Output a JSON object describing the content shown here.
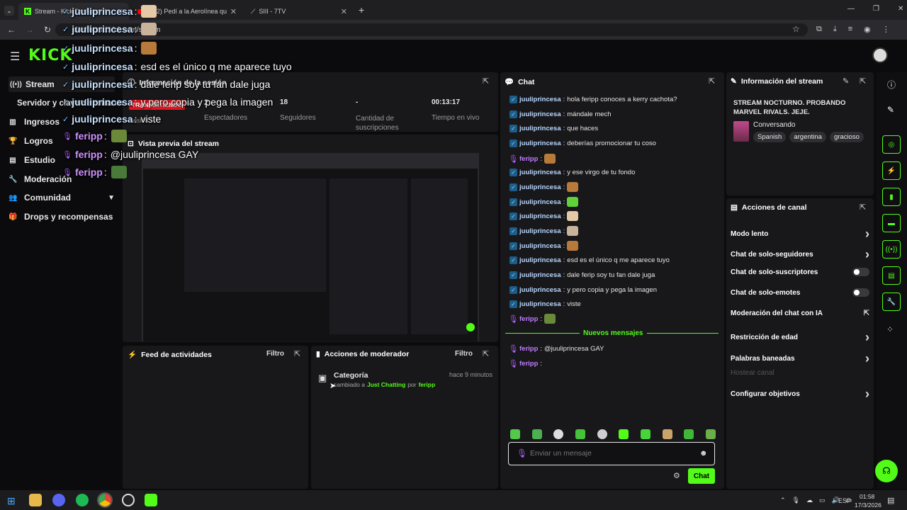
{
  "browser": {
    "tabs": [
      {
        "title": "Stream - Kick Dashboard"
      },
      {
        "title": "(332) Pedí a la Aerolínea que D"
      },
      {
        "title": "SIII - 7TV"
      }
    ],
    "url": "dashboard.kick.com/stream"
  },
  "kick": {
    "logo": "KICK"
  },
  "sidebar": {
    "items": [
      {
        "label": "Stream",
        "icon": "broadcast-icon"
      },
      {
        "label": "Servidor y clave de retransm",
        "icon": ""
      },
      {
        "label": "Ingresos",
        "icon": "bar-chart-icon"
      },
      {
        "label": "Logros",
        "icon": "trophy-icon"
      },
      {
        "label": "Estudio",
        "icon": "folder-icon"
      },
      {
        "label": "Moderación",
        "icon": "wrench-icon"
      },
      {
        "label": "Comunidad",
        "icon": "users-icon"
      },
      {
        "label": "Drops y recompensas",
        "icon": "gift-icon"
      }
    ]
  },
  "session": {
    "title": "Información de la sesión",
    "live_badge": "TRANSMITIENDO",
    "session_label": "Sesión",
    "stats": [
      {
        "value": "2",
        "label": "Espectadores"
      },
      {
        "value": "18",
        "label": "Seguidores"
      },
      {
        "value": "-",
        "label": "Cantidad de suscripciones"
      },
      {
        "value": "00:13:17",
        "label": "Tiempo en vivo"
      }
    ]
  },
  "preview": {
    "title": "Vista previa del stream"
  },
  "feed": {
    "title": "Feed de actividades",
    "filter": "Filtro"
  },
  "modactions": {
    "title": "Acciones de moderador",
    "filter": "Filtro",
    "item_title": "Categoría",
    "item_time": "hace 9 minutos",
    "item_pre": "cambiado a",
    "item_cat": "Just Chatting",
    "item_by": "por",
    "item_user": "feripp"
  },
  "chat": {
    "title": "Chat",
    "messages": [
      {
        "user": "juuliprincesa",
        "text": "hola feripp conoces a kerry cachota?",
        "emote": ""
      },
      {
        "user": "juuliprincesa",
        "text": "mándale mech",
        "emote": ""
      },
      {
        "user": "juuliprincesa",
        "text": "que haces",
        "emote": ""
      },
      {
        "user": "juuliprincesa",
        "text": "deberías promocionar tu coso",
        "emote": ""
      },
      {
        "user": "feripp",
        "text": "",
        "emote": "#b77a3a"
      },
      {
        "user": "juuliprincesa",
        "text": "y ese virgo de tu fondo",
        "emote": ""
      },
      {
        "user": "juuliprincesa",
        "text": "",
        "emote": "#b77a3a"
      },
      {
        "user": "juuliprincesa",
        "text": "",
        "emote": "#5fd23a"
      },
      {
        "user": "juuliprincesa",
        "text": "",
        "emote": "#e5c9a6"
      },
      {
        "user": "juuliprincesa",
        "text": "",
        "emote": "#c9b39a"
      },
      {
        "user": "juuliprincesa",
        "text": "",
        "emote": "#b77a3a"
      },
      {
        "user": "juuliprincesa",
        "text": "esd es el único q me aparece tuyo",
        "emote": ""
      },
      {
        "user": "juuliprincesa",
        "text": "dale ferip soy tu fan dale juga",
        "emote": ""
      },
      {
        "user": "juuliprincesa",
        "text": "y pero copia y pega la imagen",
        "emote": ""
      },
      {
        "user": "juuliprincesa",
        "text": "viste",
        "emote": ""
      },
      {
        "user": "feripp",
        "text": "",
        "emote": "#6a8a3a"
      }
    ],
    "new_messages": "Nuevos mensajes",
    "new": [
      {
        "user": "feripp",
        "text": "@juuliprincesa GAY"
      },
      {
        "user": "feripp",
        "text": ""
      }
    ],
    "placeholder": "Enviar un mensaje",
    "send": "Chat"
  },
  "streaminfo": {
    "title": "Información del stream",
    "stream_title": "STREAM NOCTURNO. PROBANDO MARVEL RIVALS. JEJE.",
    "category": "Conversando",
    "tags": [
      "Spanish",
      "argentina",
      "gracioso"
    ]
  },
  "channel": {
    "title": "Acciones de canal",
    "actions": [
      {
        "label": "Modo lento",
        "kind": "arrow"
      },
      {
        "label": "Chat de solo-seguidores",
        "kind": "arrow"
      },
      {
        "label": "Chat de solo-suscriptores",
        "kind": "toggle"
      },
      {
        "label": "Chat de solo-emotes",
        "kind": "toggle"
      },
      {
        "label": "Moderación del chat con IA",
        "kind": "external"
      },
      {
        "label": "Restricción de edad",
        "kind": "arrow"
      },
      {
        "label": "Palabras baneadas",
        "kind": "arrow"
      },
      {
        "label": "Hostear canal",
        "kind": "disabled"
      },
      {
        "label": "Configurar objetivos",
        "kind": "arrow"
      }
    ]
  },
  "overlay": {
    "lines": [
      {
        "user": "juuliprincesa",
        "text": "",
        "emote": "#e5c9a6"
      },
      {
        "user": "juuliprincesa",
        "text": "",
        "emote": "#c9b39a"
      },
      {
        "user": "juuliprincesa",
        "text": "",
        "emote": "#b77a3a"
      },
      {
        "user": "juuliprincesa",
        "text": "esd es el único q me aparece tuyo",
        "emote": ""
      },
      {
        "user": "juuliprincesa",
        "text": "dale ferip soy tu fan dale juga",
        "emote": ""
      },
      {
        "user": "juuliprincesa",
        "text": "y pero copia y pega la imagen",
        "emote": ""
      },
      {
        "user": "juuliprincesa",
        "text": "viste",
        "emote": ""
      },
      {
        "user": "feripp",
        "text": "",
        "emote": "#6a8a3a"
      },
      {
        "user": "feripp",
        "text": "@juuliprincesa GAY",
        "emote": ""
      },
      {
        "user": "feripp",
        "text": "",
        "emote": "#4a7a3a"
      }
    ]
  },
  "taskbar": {
    "lang": "ESP",
    "time": "01:58",
    "date": "17/3/2026"
  },
  "colors": {
    "accent": "#53fc18",
    "bg": "#0b0b0d",
    "panel": "#18181b"
  }
}
